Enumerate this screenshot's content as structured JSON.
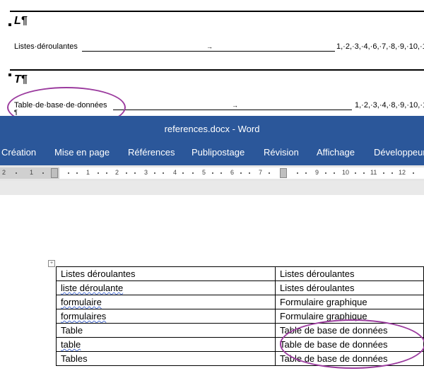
{
  "index": {
    "section_l": "L¶",
    "section_t": "T¶",
    "entries": [
      {
        "label": "Listes·déroulantes",
        "tab_symbol": "→",
        "pages": "1,·2,·3,·4,·6,·7,·8,·9,·10,·1"
      },
      {
        "label": "Table·de·base·de·données",
        "tab_symbol": "→",
        "pages": "1,·2,·3,·4,·8,·9,·10,·1"
      }
    ],
    "trailing_mark": "¶"
  },
  "window": {
    "title": "references.docx  -  Word"
  },
  "ribbon": {
    "tabs": [
      "Création",
      "Mise en page",
      "Références",
      "Publipostage",
      "Révision",
      "Affichage",
      "Développeur"
    ]
  },
  "ruler": {
    "labels": [
      "2",
      "1",
      "1",
      "2",
      "3",
      "4",
      "5",
      "6",
      "7",
      "9",
      "10",
      "11",
      "12"
    ]
  },
  "table": {
    "move_handle": "+",
    "rows": [
      {
        "term": "Listes déroulantes",
        "reference": "Listes déroulantes",
        "term_flagged": false
      },
      {
        "term": "liste déroulante",
        "reference": "Listes déroulantes",
        "term_flagged": true
      },
      {
        "term": "formulaire",
        "reference": "Formulaire graphique",
        "term_flagged": true
      },
      {
        "term": "formulaires",
        "reference": "Formulaire graphique",
        "term_flagged": true
      },
      {
        "term": "Table",
        "reference": "Table de base de données",
        "term_flagged": false
      },
      {
        "term": "table",
        "reference": "Table de base de données",
        "term_flagged": true
      },
      {
        "term": "Tables",
        "reference": "Table de base de données",
        "term_flagged": false
      }
    ]
  },
  "colors": {
    "title_bar": "#2b579a",
    "highlight_ellipse": "#9b3b9e",
    "spell_squiggle": "#4a6fd3"
  }
}
